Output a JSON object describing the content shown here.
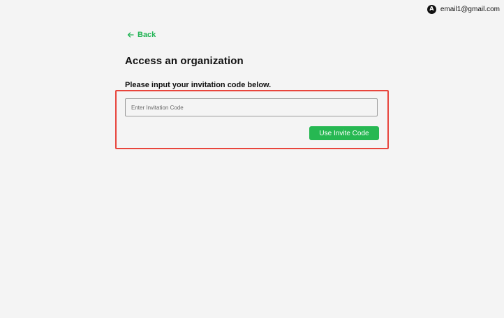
{
  "account": {
    "avatar_letter": "A",
    "email": "email1@gmail.com"
  },
  "back_link": {
    "label": "Back",
    "icon": "arrow-left-icon",
    "color": "#22b455"
  },
  "page": {
    "title": "Access an organization",
    "instruction": "Please input your invitation code below."
  },
  "invite_form": {
    "code_placeholder": "Enter Invitation Code",
    "code_value": "",
    "submit_label": "Use Invite Code",
    "submit_color": "#26b852"
  },
  "highlight": {
    "color": "#e8453c"
  }
}
